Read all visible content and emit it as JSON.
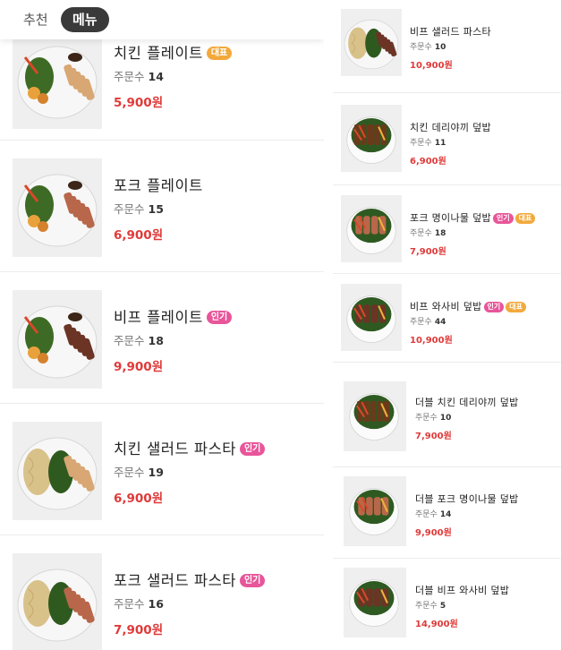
{
  "tabs": {
    "recommend": "추천",
    "menu": "메뉴"
  },
  "orders_label": "주문수",
  "left_items": [
    {
      "name": "치킨 플레이트",
      "badges": [
        "대표"
      ],
      "orders": "14",
      "price": "5,900원",
      "dish": "chicken-plate"
    },
    {
      "name": "포크 플레이트",
      "badges": [],
      "orders": "15",
      "price": "6,900원",
      "dish": "pork-plate"
    },
    {
      "name": "비프 플레이트",
      "badges": [
        "인기"
      ],
      "orders": "18",
      "price": "9,900원",
      "dish": "beef-plate"
    },
    {
      "name": "치킨 샐러드 파스타",
      "badges": [
        "인기"
      ],
      "orders": "19",
      "price": "6,900원",
      "dish": "chicken-pasta"
    },
    {
      "name": "포크 샐러드 파스타",
      "badges": [
        "인기"
      ],
      "orders": "16",
      "price": "7,900원",
      "dish": "pork-pasta"
    }
  ],
  "right_items": [
    {
      "name": "비프 샐러드 파스타",
      "badges": [],
      "orders": "10",
      "price": "10,900원",
      "dish": "beef-pasta"
    },
    {
      "name": "치킨 데리야끼 덮밥",
      "badges": [],
      "orders": "11",
      "price": "6,900원",
      "dish": "teriyaki-bowl"
    },
    {
      "name": "포크 명이나물 덮밥",
      "badges": [
        "인기",
        "대표"
      ],
      "orders": "18",
      "price": "7,900원",
      "dish": "pork-bowl"
    },
    {
      "name": "비프 와사비 덮밥",
      "badges": [
        "인기",
        "대표"
      ],
      "orders": "44",
      "price": "10,900원",
      "dish": "beef-bowl"
    },
    {
      "name": "더블 치킨 데리야끼 덮밥",
      "badges": [],
      "orders": "10",
      "price": "7,900원",
      "dish": "double-teriyaki-bowl"
    },
    {
      "name": "더블 포크 명이나물 덮밥",
      "badges": [],
      "orders": "14",
      "price": "9,900원",
      "dish": "double-pork-bowl"
    },
    {
      "name": "더블 비프 와사비 덮밥",
      "badges": [],
      "orders": "5",
      "price": "14,900원",
      "dish": "double-beef-bowl"
    }
  ],
  "colors": {
    "price": "#e03a3a",
    "badge_popular": "#e8559a",
    "badge_representative": "#f2a93b",
    "tab_active": "#3a3a3a"
  }
}
